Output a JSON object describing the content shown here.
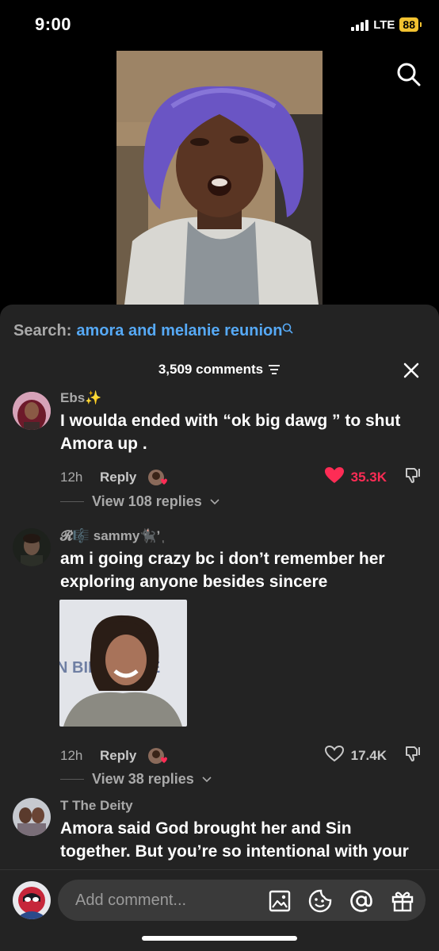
{
  "status_bar": {
    "time": "9:00",
    "network": "LTE",
    "battery": "88"
  },
  "search_bar": {
    "prefix": "Search:",
    "query": "amora and melanie reunion"
  },
  "comments_header": {
    "count_label": "3,509 comments"
  },
  "comments": [
    {
      "username": "Ebs✨",
      "text": "I woulda ended with “ok big dawg ” to shut Amora up .",
      "time": "12h",
      "reply_label": "Reply",
      "likes": "35.3K",
      "liked": true,
      "view_replies": "View 108 replies"
    },
    {
      "username": "𝓡🎼 sammy🐈‍⬛’ ᷂",
      "text": "am i going crazy bc i don’t remember her exploring anyone besides sincere",
      "time": "12h",
      "reply_label": "Reply",
      "likes": "17.4K",
      "liked": false,
      "view_replies": "View 38 replies",
      "image_text": "N BIE SAY NE"
    },
    {
      "username": "T The Deity",
      "text": "Amora said God brought her and Sin together. But you’re so intentional with your",
      "time": "",
      "reply_label": ""
    }
  ],
  "composer": {
    "placeholder": "Add comment..."
  },
  "icons": {
    "search": "search-icon",
    "filter": "filter-icon",
    "close": "close-icon",
    "heart_filled": "heart-filled-icon",
    "heart_outline": "heart-outline-icon",
    "dislike": "dislike-icon",
    "chevron": "chevron-down-icon",
    "image": "image-icon",
    "emoji": "emoji-icon",
    "mention": "at-icon",
    "gift": "gift-icon"
  },
  "colors": {
    "accent": "#fe2c55",
    "link": "#56a9f5",
    "sheet": "#232323",
    "battery": "#f2c230"
  }
}
